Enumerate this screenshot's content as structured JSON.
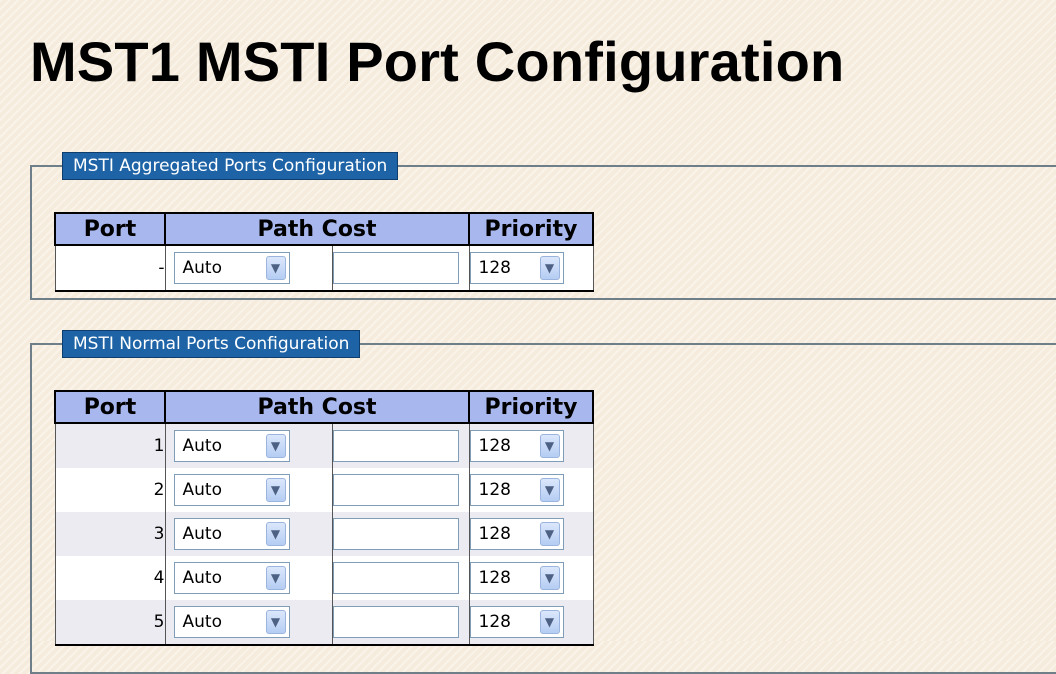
{
  "page": {
    "title": "MST1 MSTI Port Configuration"
  },
  "aggregated": {
    "legend": "MSTI Aggregated Ports Configuration",
    "headers": {
      "port": "Port",
      "path_cost": "Path Cost",
      "priority": "Priority"
    },
    "rows": [
      {
        "port": "-",
        "path_cost_mode": "Auto",
        "path_cost_value": "",
        "priority": "128"
      }
    ]
  },
  "normal": {
    "legend": "MSTI Normal Ports Configuration",
    "headers": {
      "port": "Port",
      "path_cost": "Path Cost",
      "priority": "Priority"
    },
    "rows": [
      {
        "port": "1",
        "path_cost_mode": "Auto",
        "path_cost_value": "",
        "priority": "128"
      },
      {
        "port": "2",
        "path_cost_mode": "Auto",
        "path_cost_value": "",
        "priority": "128"
      },
      {
        "port": "3",
        "path_cost_mode": "Auto",
        "path_cost_value": "",
        "priority": "128"
      },
      {
        "port": "4",
        "path_cost_mode": "Auto",
        "path_cost_value": "",
        "priority": "128"
      },
      {
        "port": "5",
        "path_cost_mode": "Auto",
        "path_cost_value": "",
        "priority": "128"
      }
    ]
  },
  "icons": {
    "dropdown": "chevron-down-icon"
  },
  "colors": {
    "legend_bg": "#1d63a6",
    "header_bg": "#a9b7ef",
    "page_bg": "#f6ecdd"
  }
}
